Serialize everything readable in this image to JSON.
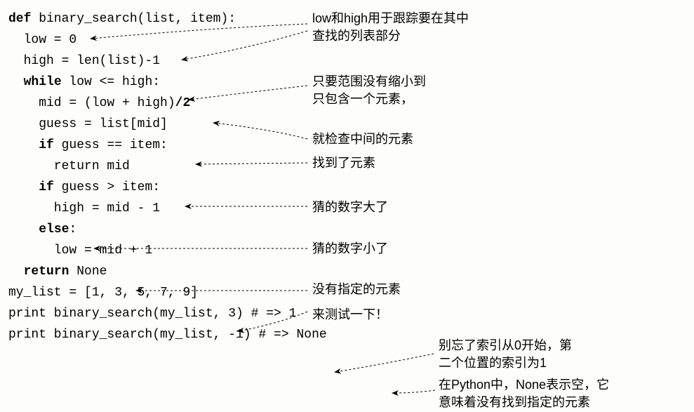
{
  "code": {
    "l1": {
      "a": "def",
      "b": " binary_search(list, item):"
    },
    "l2": "  low = 0",
    "l3": "  high = len(list)-1",
    "l4": "",
    "l5": {
      "a": "  ",
      "b": "while",
      "c": " low <= high:"
    },
    "l6": "    mid = (low + high)",
    "l6b": "/2",
    "l7": "    guess = list[mid]",
    "l8": {
      "a": "    ",
      "b": "if",
      "c": " guess == item:"
    },
    "l9": "      return mid",
    "l10": {
      "a": "    ",
      "b": "if",
      "c": " guess > item:"
    },
    "l11": "      high = mid - 1",
    "l12": {
      "a": "    ",
      "b": "else",
      "c": ":"
    },
    "l13": "      low = mid + 1",
    "l14": {
      "a": "  ",
      "b": "return",
      "c": " None"
    },
    "l15": "",
    "l16": "my_list = [1, 3, 5, 7, 9]",
    "l17": "",
    "l18": "print binary_search(my_list, 3) # => 1",
    "l19": "print binary_search(my_list, -1) # => None"
  },
  "ann": {
    "a1l1": "low和high用于跟踪要在其中",
    "a1l2": "查找的列表部分",
    "a2l1": "只要范围没有缩小到",
    "a2l2": "只包含一个元素，",
    "a3": "就检查中间的元素",
    "a4": "找到了元素",
    "a5": "猜的数字大了",
    "a6": "猜的数字小了",
    "a7": "没有指定的元素",
    "a8": "来测试一下！",
    "a9l1": "别忘了索引从0开始，第",
    "a9l2": "二个位置的索引为1",
    "a10l1": "在Python中，None表示空，它",
    "a10l2": "意味着没有找到指定的元素"
  }
}
